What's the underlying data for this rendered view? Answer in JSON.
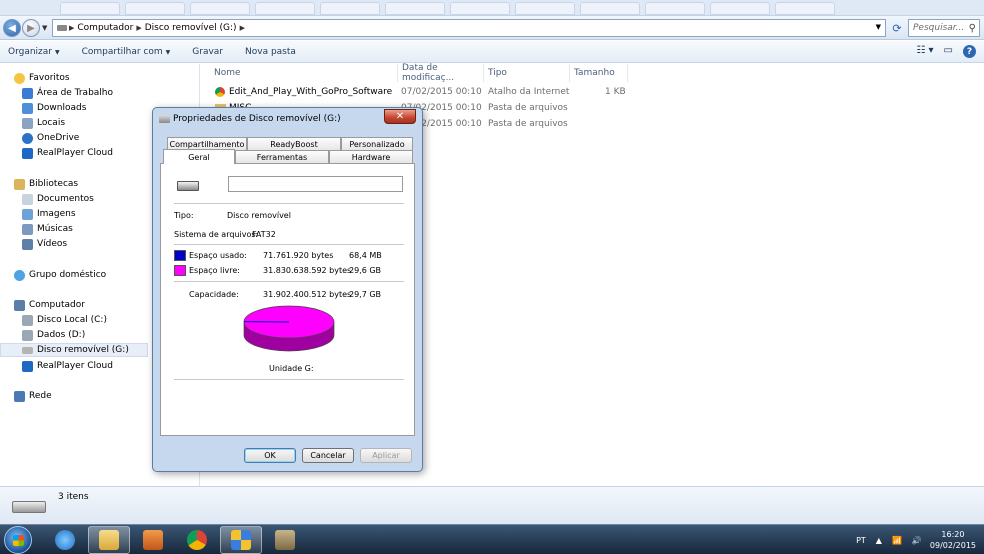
{
  "address": {
    "root": "Computador",
    "current": "Disco removível (G:)",
    "search_placeholder": "Pesquisar..."
  },
  "toolbar": {
    "organize": "Organizar",
    "share": "Compartilhar com",
    "burn": "Gravar",
    "new_folder": "Nova pasta"
  },
  "nav": {
    "favorites": "Favoritos",
    "desktop": "Área de Trabalho",
    "downloads": "Downloads",
    "recent": "Locais",
    "onedrive": "OneDrive",
    "realplayer1": "RealPlayer Cloud",
    "libraries": "Bibliotecas",
    "documents": "Documentos",
    "images": "Imagens",
    "music": "Músicas",
    "videos": "Vídeos",
    "homegroup": "Grupo doméstico",
    "computer": "Computador",
    "local_disk": "Disco Local (C:)",
    "data_disk": "Dados (D:)",
    "removable": "Disco removível (G:)",
    "realplayer2": "RealPlayer Cloud",
    "network": "Rede"
  },
  "columns": {
    "name": "Nome",
    "date": "Data de modificaç...",
    "type": "Tipo",
    "size": "Tamanho"
  },
  "files": [
    {
      "name": "Edit_And_Play_With_GoPro_Software",
      "date": "07/02/2015 00:10",
      "type": "Atalho da Internet",
      "size": "1 KB"
    },
    {
      "name": "MISC",
      "date": "07/02/2015 00:10",
      "type": "Pasta de arquivos",
      "size": ""
    },
    {
      "name": "",
      "date": "07/02/2015 00:10",
      "type": "Pasta de arquivos",
      "size": ""
    }
  ],
  "status": {
    "count": "3 itens"
  },
  "dialog": {
    "title": "Propriedades de Disco removível (G:)",
    "close": "✕",
    "tabs_top": [
      "Compartilhamento",
      "ReadyBoost",
      "Personalizado"
    ],
    "tabs_bottom": [
      "Geral",
      "Ferramentas",
      "Hardware"
    ],
    "name_value": "",
    "type_label": "Tipo:",
    "type_value": "Disco removível",
    "fs_label": "Sistema de arquivos:",
    "fs_value": "FAT32",
    "used_label": "Espaço usado:",
    "used_bytes": "71.761.920 bytes",
    "used_size": "68,4 MB",
    "free_label": "Espaço livre:",
    "free_bytes": "31.830.638.592 bytes",
    "free_size": "29,6 GB",
    "cap_label": "Capacidade:",
    "cap_bytes": "31.902.400.512 bytes",
    "cap_size": "29,7 GB",
    "drive_label": "Unidade G:",
    "ok": "OK",
    "cancel": "Cancelar",
    "apply": "Aplicar",
    "used_color": "#0000c8",
    "free_color": "#ff00ff"
  },
  "taskbar": {
    "lang": "PT",
    "time": "16:20",
    "date": "09/02/2015"
  }
}
